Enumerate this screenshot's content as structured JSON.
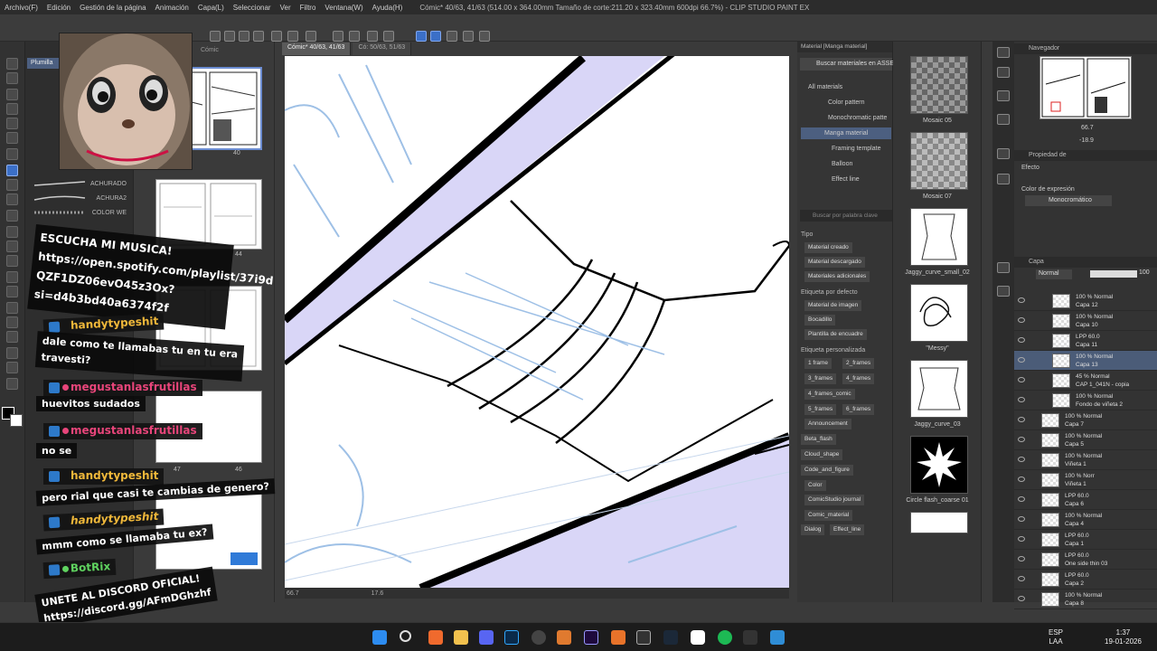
{
  "window": {
    "title": "Cómic* 40/63, 41/63 (514.00 x 364.00mm Tamaño de corte:211.20 x 323.40mm 600dpi 66.7%) - CLIP STUDIO PAINT EX"
  },
  "menu": [
    "Archivo(F)",
    "Edición",
    "Gestión de la página",
    "Animación",
    "Capa(L)",
    "Seleccionar",
    "Ver",
    "Filtro",
    "Ventana(W)",
    "Ayuda(H)"
  ],
  "tabs": [
    "Cómic* 40/63, 41/63",
    "Có: 50/63, 51/63"
  ],
  "left_tab": "Cómic",
  "subtool": {
    "tab": "Plumilla",
    "brushes": [
      "ACHURADO",
      "ACHURA2",
      "COLOR WE"
    ]
  },
  "pages": {
    "labels": [
      "40",
      "45",
      "44",
      "47",
      "46",
      "48"
    ]
  },
  "canvas_status": {
    "zoom": "66.7",
    "angle": "17.6"
  },
  "materials": {
    "header": "Material [Manga material]",
    "search_button": "Buscar materiales en ASSETS",
    "tree": [
      "All materials",
      "Color pattern",
      "Monochromatic patte",
      "Manga material",
      "Framing template",
      "Balloon",
      "Effect line"
    ],
    "keyword_placeholder": "Buscar por palabra clave",
    "sections": {
      "tipo": "Tipo",
      "default_tag": "Etiqueta por defecto",
      "custom_tag": "Etiqueta personalizada"
    },
    "tipo_chips": [
      "Material creado",
      "Material descargado",
      "Materiales adicionales"
    ],
    "default_chips": [
      "Material de imagen",
      "Bocadillo",
      "Plantilla de encuadre"
    ],
    "custom_chips": [
      "1 frame",
      "2_frames",
      "3_frames",
      "4_frames",
      "4_frames_comic",
      "5_frames",
      "6_frames",
      "Announcement",
      "Beta_flash",
      "Cloud_shape",
      "Code_and_figure",
      "Color",
      "ComicStudio journal",
      "Comic_material",
      "Dialog",
      "Effect_line"
    ],
    "thumbs": [
      "Mosaic 05",
      "Mosaic 07",
      "Jaggy_curve_small_02",
      "\"Messy\"",
      "Jaggy_curve_03",
      "Circle flash_coarse 01"
    ]
  },
  "navigator": {
    "title": "Navegador",
    "zoom": "66.7",
    "angle": "-18.9"
  },
  "properties": {
    "title": "Propiedad de",
    "effect": "Efecto",
    "expr_label": "Color de expresión",
    "expr_value": "Monocromático"
  },
  "layers": {
    "title": "Capa",
    "blend": "Normal",
    "opacity": "100",
    "items": [
      {
        "l1": "100 % Normal",
        "l2": "Capa 12"
      },
      {
        "l1": "100 % Normal",
        "l2": "Capa 10"
      },
      {
        "l1": "LPP 60.0",
        "l2": "Capa 11"
      },
      {
        "l1": "100 % Normal",
        "l2": "Capa 13"
      },
      {
        "l1": "45 % Normal",
        "l2": "CAP 1_041N - copia"
      },
      {
        "l1": "100 % Normal",
        "l2": "Fondo de viñeta 2"
      },
      {
        "l1": "100 % Normal",
        "l2": "Capa 7"
      },
      {
        "l1": "100 % Normal",
        "l2": "Capa 5"
      },
      {
        "l1": "100 % Normal",
        "l2": "Viñeta 1"
      },
      {
        "l1": "100 % Norr",
        "l2": "Viñeta 1"
      },
      {
        "l1": "LPP 60.0",
        "l2": "Capa 6"
      },
      {
        "l1": "100 % Normal",
        "l2": "Capa 4"
      },
      {
        "l1": "LPP 60.0",
        "l2": "Capa 1"
      },
      {
        "l1": "LPP 60.0",
        "l2": "One side thin 03"
      },
      {
        "l1": "LPP 60.0",
        "l2": "Capa 2"
      },
      {
        "l1": "100 % Normal",
        "l2": "Capa 8"
      }
    ]
  },
  "chat": {
    "header": [
      "ESCUCHA MI MUSICA!",
      "https://open.spotify.com/playlist/37i9d",
      "QZF1DZ06evO45z3Ox?",
      "si=d4b3bd40a6374f2f"
    ],
    "messages": [
      {
        "user": "handytypeshit",
        "user_color": "#f0b83a",
        "text": [
          "dale como te llamabas tu en tu era",
          "travesti?"
        ]
      },
      {
        "user": "megustanlasfrutillas",
        "user_color": "#e8457a",
        "text": [
          "huevitos sudados"
        ]
      },
      {
        "user": "megustanlasfrutillas",
        "user_color": "#e8457a",
        "text": [
          "no se"
        ]
      },
      {
        "user": "handytypeshit",
        "user_color": "#f0b83a",
        "text": [
          "pero rial que casi te cambias de genero?"
        ]
      },
      {
        "user": "handytypeshit",
        "user_color": "#f0b83a",
        "text": [
          "mmm como se llamaba tu ex?"
        ]
      },
      {
        "user": "BotRix",
        "user_color": "#5fd35f",
        "text": [
          "UNETE AL DISCORD OFICIAL!",
          "https://discord.gg/AFmDGhzhf"
        ]
      }
    ]
  },
  "taskbar": {
    "lang1": "ESP",
    "lang2": "LAA",
    "time": "1:37",
    "date": "19-01-2026"
  },
  "colors": {
    "accent": "#3b6fc7",
    "panel_fill": "#d9d6f7"
  }
}
